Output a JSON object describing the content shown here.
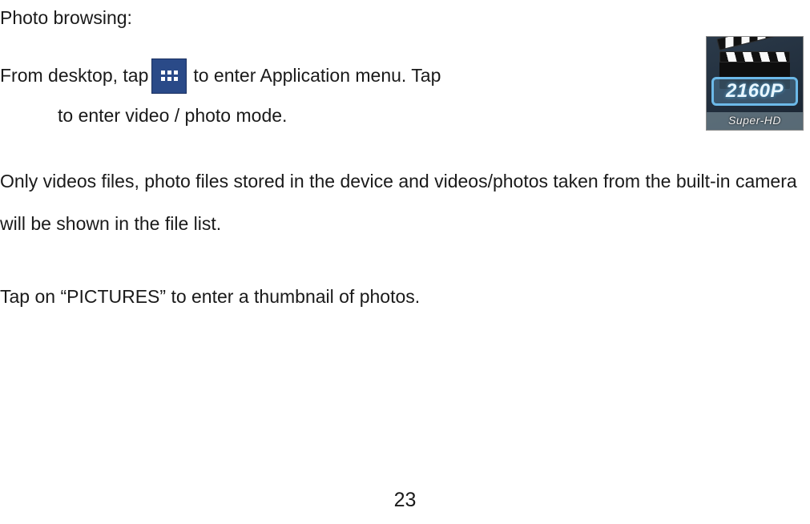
{
  "heading": "Photo browsing:",
  "line1_a": "From desktop, tap ",
  "line1_b": "  to enter Application menu.   Tap ",
  "line2": "to enter video / photo mode.",
  "para2": "Only videos files, photo files stored in the device and videos/photos taken from the built-in camera will be shown in the file list.",
  "para3": "Tap on “PICTURES” to enter a thumbnail of photos.",
  "page_number": "23",
  "badge_text": "2160P",
  "super_hd_text": "Super-HD"
}
